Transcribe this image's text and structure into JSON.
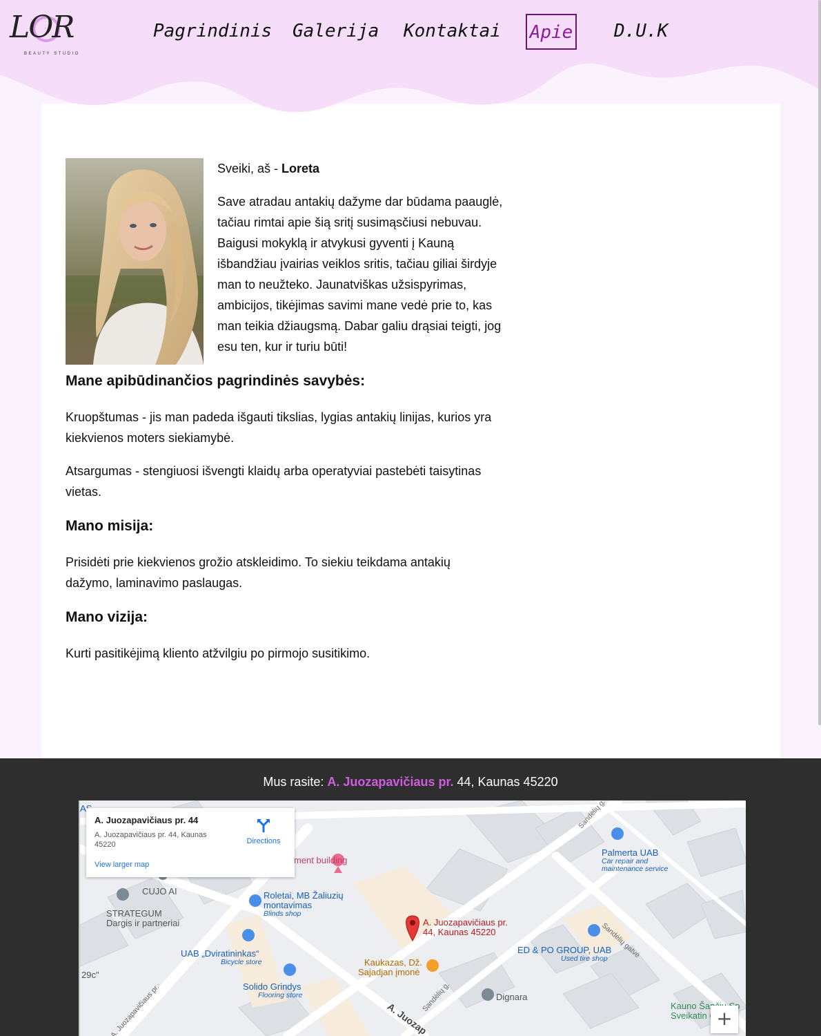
{
  "brand": {
    "logo_text": "LOR",
    "logo_subtitle": "BEAUTY   STUDIO"
  },
  "nav": {
    "items": [
      {
        "label": "Pagrindinis",
        "active": false
      },
      {
        "label": "Galerija",
        "active": false
      },
      {
        "label": "Kontaktai",
        "active": false
      },
      {
        "label": "Apie",
        "active": true
      },
      {
        "label": "D.U.K",
        "active": false
      }
    ]
  },
  "about": {
    "greeting_prefix": "Sveiki, aš - ",
    "greeting_name": "Loreta",
    "intro_lines": [
      "Save atradau antakių dažyme dar būdama paauglė,",
      "tačiau rimtai apie šią sritį susimąsčiusi nebuvau.",
      "Baigusi mokyklą ir atvykusi gyventi į Kauną",
      "išbandžiau įvairias veiklos sritis, tačiau giliai širdyje",
      "man to neužteko. Jaunatviškas užsispyrimas,",
      "ambicijos, tikėjimas savimi mane vedė prie to, kas",
      "man teikia džiaugsmą. Dabar galiu drąsiai teigti, jog",
      "esu ten, kur ir turiu būti!"
    ],
    "traits_heading": "Mane apibūdinančios pagrindinės savybės:",
    "trait_1_lines": [
      "Kruopštumas - jis man padeda išgauti tikslias, lygias antakių linijas, kurios yra",
      "kiekvienos moters siekiamybė."
    ],
    "trait_2_lines": [
      "Atsargumas - stengiuosi išvengti klaidų arba operatyviai pastebėti taisytinas",
      "vietas."
    ],
    "mission_heading": "Mano misija:",
    "mission_lines": [
      "Prisidėti prie kiekvienos grožio atskleidimo. To siekiu teikdama antakių",
      "dažymo, laminavimo paslaugas."
    ],
    "vision_heading": "Mano vizija:",
    "vision_text": "Kurti pasitikėjimą kliento atžvilgiu po pirmojo susitikimo."
  },
  "footer": {
    "find_us_prefix": "Mus rasite: ",
    "street_highlight": "A. Juozapavičiaus pr.",
    "address_rest": " 44, Kaunas 45220"
  },
  "map": {
    "card_title": "A. Juozapavičiaus pr. 44",
    "card_address": "A. Juozapavičiaus pr. 44, Kaunas 45220",
    "directions_label": "Directions",
    "view_larger_label": "View larger map",
    "zoom_in_label": "+",
    "pin_label_1": "A. Juozapavičiaus pr.",
    "pin_label_2": "44, Kaunas 45220",
    "places": {
      "apartment": "ment building",
      "cujo": "CUJO AI",
      "strategum": "STRATEGUM",
      "dargis": "Dargis ir partneriai",
      "roletai_1": "Roletai, MB Žaliuzių",
      "roletai_2": "montavimas",
      "roletai_sub": "Blinds shop",
      "dviratininkas": "UAB „Dviratininkas“",
      "dviratininkas_sub": "Bicycle store",
      "solido": "Solido Grindys",
      "solido_sub": "Flooring store",
      "kaukazas_1": "Kaukazas, Dž.",
      "kaukazas_2": "Sajadjan įmonė",
      "dignara": "Dignara",
      "palmerta": "Palmerta UAB",
      "palmerta_sub_1": "Car repair and",
      "palmerta_sub_2": "maintenance service",
      "edpo": "ED & PO GROUP, UAB",
      "edpo_sub": "Used tire shop",
      "sandeliu_g": "Sandėlių g.",
      "sandeliu_gatve": "Sandėlių gatvė",
      "sandeliu_g_2": "Sandėlių g.",
      "juoz_road": "A. Juozapavičiaus pr.",
      "juoz_road_2": "A. Juozap",
      "kauno_1": "Kauno Šančių Sp",
      "kauno_2": "Sveikatin    Ce",
      "edge_29": "29c\"",
      "edge_as": "AS"
    }
  },
  "colors": {
    "accent_purple": "#cf5cdd",
    "nav_active": "#8d1a9a",
    "header_wave": "#f6defa",
    "footer_bg": "#2e2e2e",
    "map_pin": "#e53935"
  }
}
